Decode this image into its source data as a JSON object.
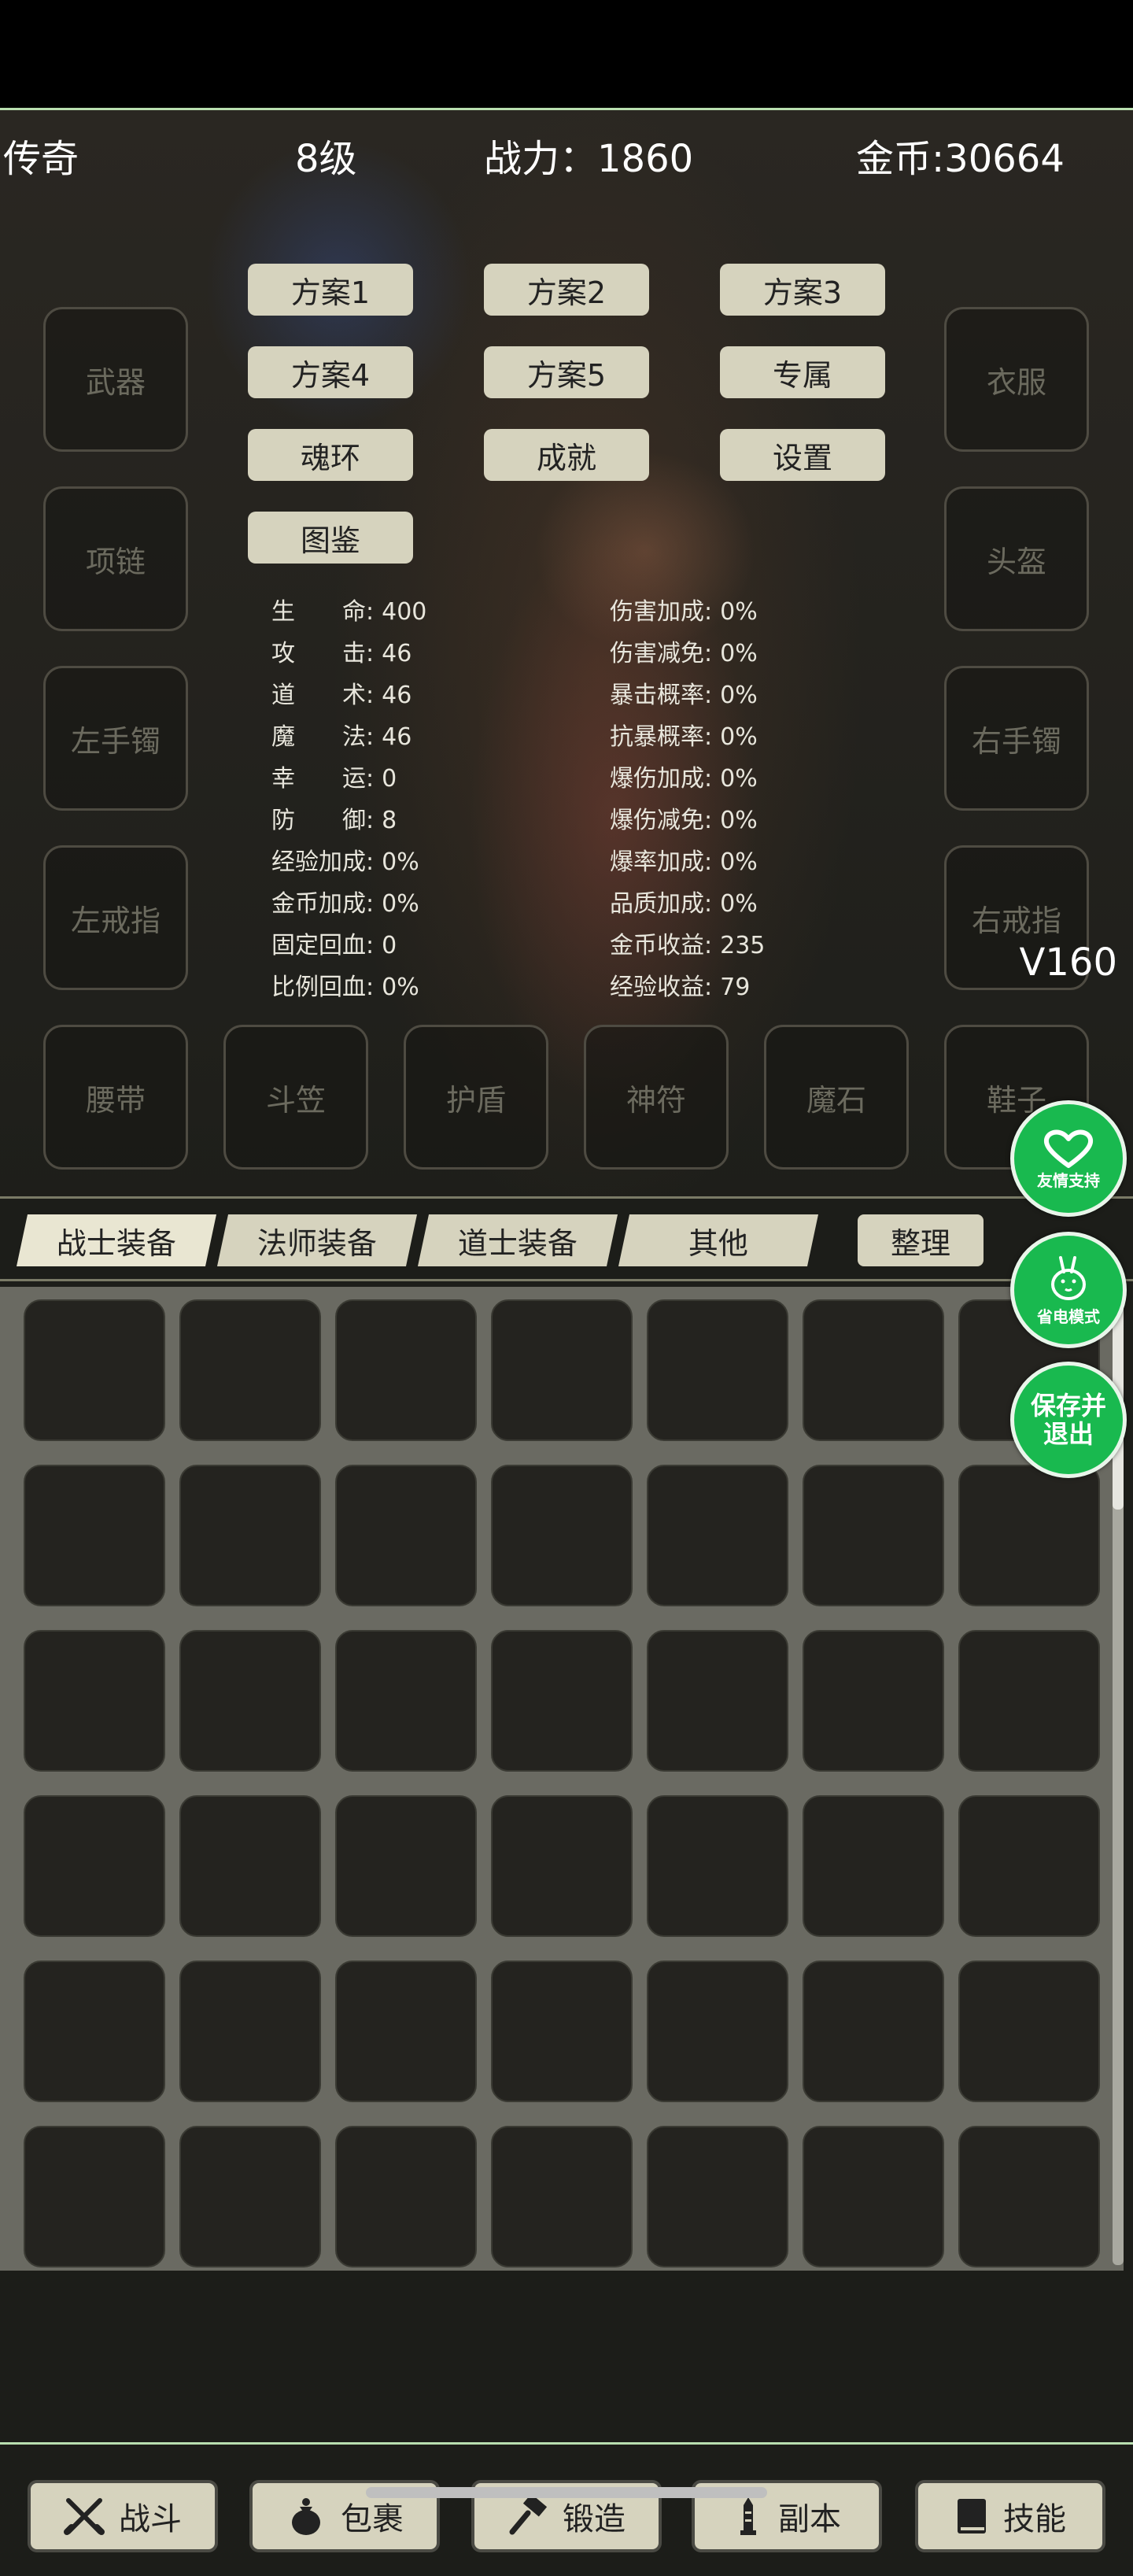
{
  "topbar": {
    "title": "传奇",
    "level": "8级",
    "power": "战力：1860",
    "gold": "金币:30664"
  },
  "equip_slots": {
    "weapon": "武器",
    "necklace": "项链",
    "left_bracelet": "左手镯",
    "left_ring": "左戒指",
    "belt": "腰带",
    "hat": "斗笠",
    "shield": "护盾",
    "talisman": "神符",
    "magic_stone": "魔石",
    "shoes": "鞋子",
    "clothes": "衣服",
    "helmet": "头盔",
    "right_bracelet": "右手镯",
    "right_ring": "右戒指"
  },
  "plan_buttons": [
    "方案1",
    "方案2",
    "方案3",
    "方案4",
    "方案5",
    "专属",
    "魂环",
    "成就",
    "设置",
    "图鉴"
  ],
  "stats_left": [
    {
      "label": "生　　命:",
      "value": "400"
    },
    {
      "label": "攻　　击:",
      "value": "46"
    },
    {
      "label": "道　　术:",
      "value": "46"
    },
    {
      "label": "魔　　法:",
      "value": "46"
    },
    {
      "label": "幸　　运:",
      "value": "0"
    },
    {
      "label": "防　　御:",
      "value": "8"
    },
    {
      "label": "经验加成:",
      "value": "0%"
    },
    {
      "label": "金币加成:",
      "value": "0%"
    },
    {
      "label": "固定回血:",
      "value": "0"
    },
    {
      "label": "比例回血:",
      "value": "0%"
    }
  ],
  "stats_right": [
    {
      "label": "伤害加成:",
      "value": "0%"
    },
    {
      "label": "伤害减免:",
      "value": "0%"
    },
    {
      "label": "暴击概率:",
      "value": "0%"
    },
    {
      "label": "抗暴概率:",
      "value": "0%"
    },
    {
      "label": "爆伤加成:",
      "value": "0%"
    },
    {
      "label": "爆伤减免:",
      "value": "0%"
    },
    {
      "label": "爆率加成:",
      "value": "0%"
    },
    {
      "label": "品质加成:",
      "value": "0%"
    },
    {
      "label": "金币收益:",
      "value": "235"
    },
    {
      "label": "经验收益:",
      "value": "79"
    }
  ],
  "version": "V160",
  "tabs": [
    "战士装备",
    "法师装备",
    "道士装备",
    "其他"
  ],
  "sort_label": "整理",
  "floating": {
    "support": "友情支持",
    "power_save": "省电模式",
    "save_exit_line1": "保存并",
    "save_exit_line2": "退出"
  },
  "bottom_nav": [
    "战斗",
    "包裹",
    "锻造",
    "副本",
    "技能"
  ],
  "icons": {
    "support": "heart-icon",
    "power_save": "rabbit-icon",
    "nav": [
      "crossed-swords-icon",
      "bag-icon",
      "hammer-icon",
      "tower-icon",
      "book-icon"
    ]
  },
  "colors": {
    "accent_green": "#19b94f",
    "button_beige": "#d6d3be",
    "frame_green": "#b9dfb0"
  }
}
